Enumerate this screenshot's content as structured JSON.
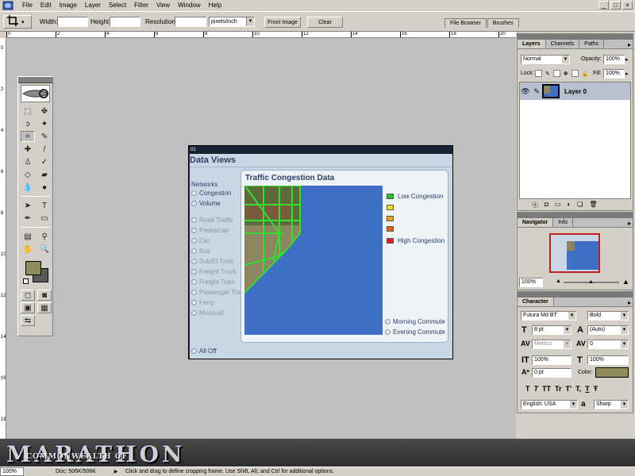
{
  "menu": {
    "items": [
      "File",
      "Edit",
      "Image",
      "Layer",
      "Select",
      "Filter",
      "View",
      "Window",
      "Help"
    ]
  },
  "window_controls": {
    "minimize": "_",
    "restore": "□",
    "close": "×"
  },
  "options_bar": {
    "tool_icon": "crop-icon",
    "width_label": "Width:",
    "width_value": "",
    "height_label": "Height:",
    "height_value": "",
    "resolution_label": "Resolution:",
    "resolution_value": "",
    "units": "pixels/inch",
    "front_image_label": "Front Image",
    "clear_label": "Clear"
  },
  "palette_well": {
    "tabs": [
      "File Browser",
      "Brushes"
    ]
  },
  "rulers": {
    "top": [
      "0",
      "2",
      "4",
      "6",
      "8",
      "10",
      "12",
      "14",
      "16",
      "18",
      "20"
    ],
    "left": [
      "0",
      "2",
      "4",
      "6",
      "8",
      "10",
      "12",
      "14",
      "16",
      "18"
    ]
  },
  "document": {
    "title_bar": "01",
    "data_views_title": "Data Views",
    "networks_label": "Networks",
    "network_items": [
      "Congestion",
      "Volume"
    ],
    "layer_items": [
      "Road Traffic",
      "Pedestrian",
      "Car",
      "Bus",
      "Sub/El Train",
      "Freight Truck",
      "Freight Train",
      "Passenger Train",
      "Ferry",
      "Monorail"
    ],
    "panel_title": "Traffic Congestion Data",
    "legend": [
      {
        "label": "Low Congestion",
        "color": "#22c022"
      },
      {
        "label": "",
        "color": "#e8e020"
      },
      {
        "label": "",
        "color": "#e8a020"
      },
      {
        "label": "",
        "color": "#e06020"
      },
      {
        "label": "High Congestion",
        "color": "#d82020"
      }
    ],
    "commute_options": [
      "Morning Commute",
      "Evening Commute"
    ],
    "all_off_label": "All Off"
  },
  "layers_palette": {
    "tabs": [
      "Layers",
      "Channels",
      "Paths"
    ],
    "blend_mode": "Normal",
    "opacity_label": "Opacity:",
    "opacity_value": "100%",
    "lock_label": "Lock:",
    "fill_label": "Fill:",
    "fill_value": "100%",
    "layer_name": "Layer 0"
  },
  "navigator_palette": {
    "tabs": [
      "Navigator",
      "Info"
    ],
    "zoom": "100%",
    "zoom_level": 0.5
  },
  "character_palette": {
    "tabs": [
      "Character"
    ],
    "font_family": "Futura Md BT",
    "font_style": "Bold",
    "size": "8 pt",
    "leading": "(Auto)",
    "kerning": "Metrics",
    "tracking": "0",
    "vertical_scale": "100%",
    "horizontal_scale": "100%",
    "baseline": "0 pt",
    "color_label": "Color:",
    "color_value": "#8f8b5b",
    "style_buttons": [
      "T",
      "T",
      "TT",
      "Tr",
      "T'",
      "T,",
      "T",
      "Ŧ"
    ],
    "language": "English: USA",
    "aa_label": "a",
    "antialias": "Sharp"
  },
  "banner": {
    "title": "MARATHON",
    "subtitle": "COMMONWEALTH OF"
  },
  "status": {
    "zoom": "100%",
    "doc": "Doc: 506K/506K",
    "hint": "Click and drag to define cropping frame. Use Shift, Alt, and Ctrl for additional options."
  }
}
